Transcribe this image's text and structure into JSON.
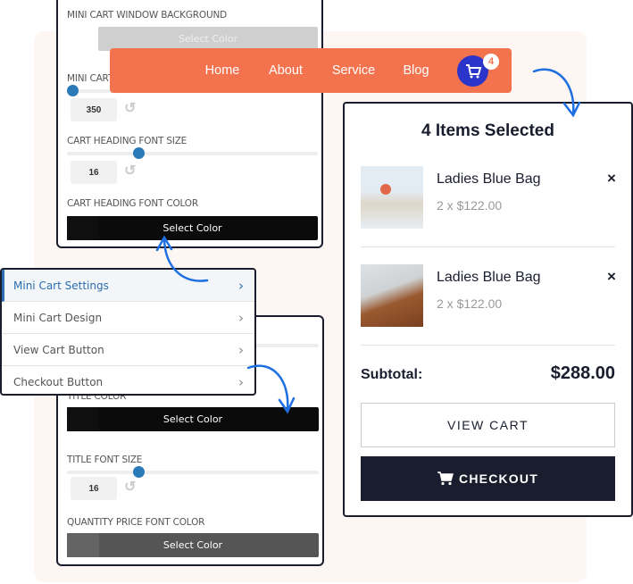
{
  "colors": {
    "accent_nav": "#f4734f",
    "cart_button": "#2b35c9",
    "dark": "#1a1d2e",
    "arrow": "#1e6fe0",
    "active_menu": "#2b6cb0"
  },
  "top_panel": {
    "window_bg_label": "MINI CART WINDOW BACKGROUND",
    "window_bg_button": "Select Color",
    "width_label": "MINI CART",
    "width_value": "350",
    "heading_size_label": "CART HEADING FONT SIZE",
    "heading_size_value": "16",
    "heading_color_label": "CART HEADING FONT COLOR",
    "heading_color_button": "Select Color"
  },
  "nav": {
    "items": [
      "Home",
      "About",
      "Service",
      "Blog"
    ],
    "cart_icon": "cart-icon",
    "cart_count": "4"
  },
  "cart": {
    "title": "4 Items Selected",
    "items": [
      {
        "name": "Ladies Blue Bag",
        "price": "2 x $122.00"
      },
      {
        "name": "Ladies Blue Bag",
        "price": "2 x $122.00"
      }
    ],
    "remove_icon": "×",
    "subtotal_label": "Subtotal:",
    "subtotal_value": "$288.00",
    "view_cart": "VIEW CART",
    "checkout": "CHECKOUT"
  },
  "menu": {
    "items": [
      "Mini Cart Settings",
      "Mini Cart Design",
      "View Cart Button",
      "Checkout Button"
    ],
    "active": "Mini Cart Settings"
  },
  "bottom_panel": {
    "title_color_label": "TITLE COLOR",
    "title_color_button": "Select Color",
    "title_size_label": "TITLE FONT SIZE",
    "title_size_value": "16",
    "qty_color_label": "QUANTITY PRICE FONT COLOR",
    "qty_color_button": "Select Color"
  }
}
